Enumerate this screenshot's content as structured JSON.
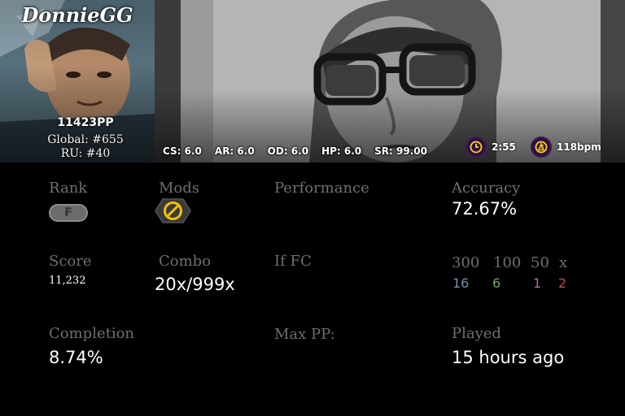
{
  "player": {
    "username": "DonnieGG",
    "pp": "11423PP",
    "global_rank": "Global: #655",
    "country_rank": "RU: #40"
  },
  "beatmap_stats": {
    "cs": "CS: 6.0",
    "ar": "AR: 6.0",
    "od": "OD: 6.0",
    "hp": "HP: 6.0",
    "sr": "SR: 99.00",
    "length": "2:55",
    "bpm": "118bpm"
  },
  "score": {
    "rank_label": "Rank",
    "rank_letter": "F",
    "mods_label": "Mods",
    "mods": [
      "no-mod-icon"
    ],
    "performance_label": "Performance",
    "performance_value": "",
    "accuracy_label": "Accuracy",
    "accuracy_value": "72.67%",
    "score_label": "Score",
    "score_value": "11,232",
    "combo_label": "Combo",
    "combo_value": "20x/999x",
    "if_fc_label": "If FC",
    "hits": {
      "headers": [
        "300",
        "100",
        "50",
        "x"
      ],
      "values": [
        "16",
        "6",
        "1",
        "2"
      ],
      "colors": [
        "#6e8fb5",
        "#6fa85a",
        "#b36ab0",
        "#b9523f"
      ]
    },
    "completion_label": "Completion",
    "completion_value": "8.74%",
    "max_pp_label": "Max PP:",
    "played_label": "Played",
    "played_value": "15 hours ago"
  },
  "colors": {
    "background": "#000000",
    "label_gray": "#6f6f6f",
    "badge_purple": "#2b0f3d",
    "badge_yellow": "#f0c419",
    "mod_yellow": "#f2c200"
  }
}
